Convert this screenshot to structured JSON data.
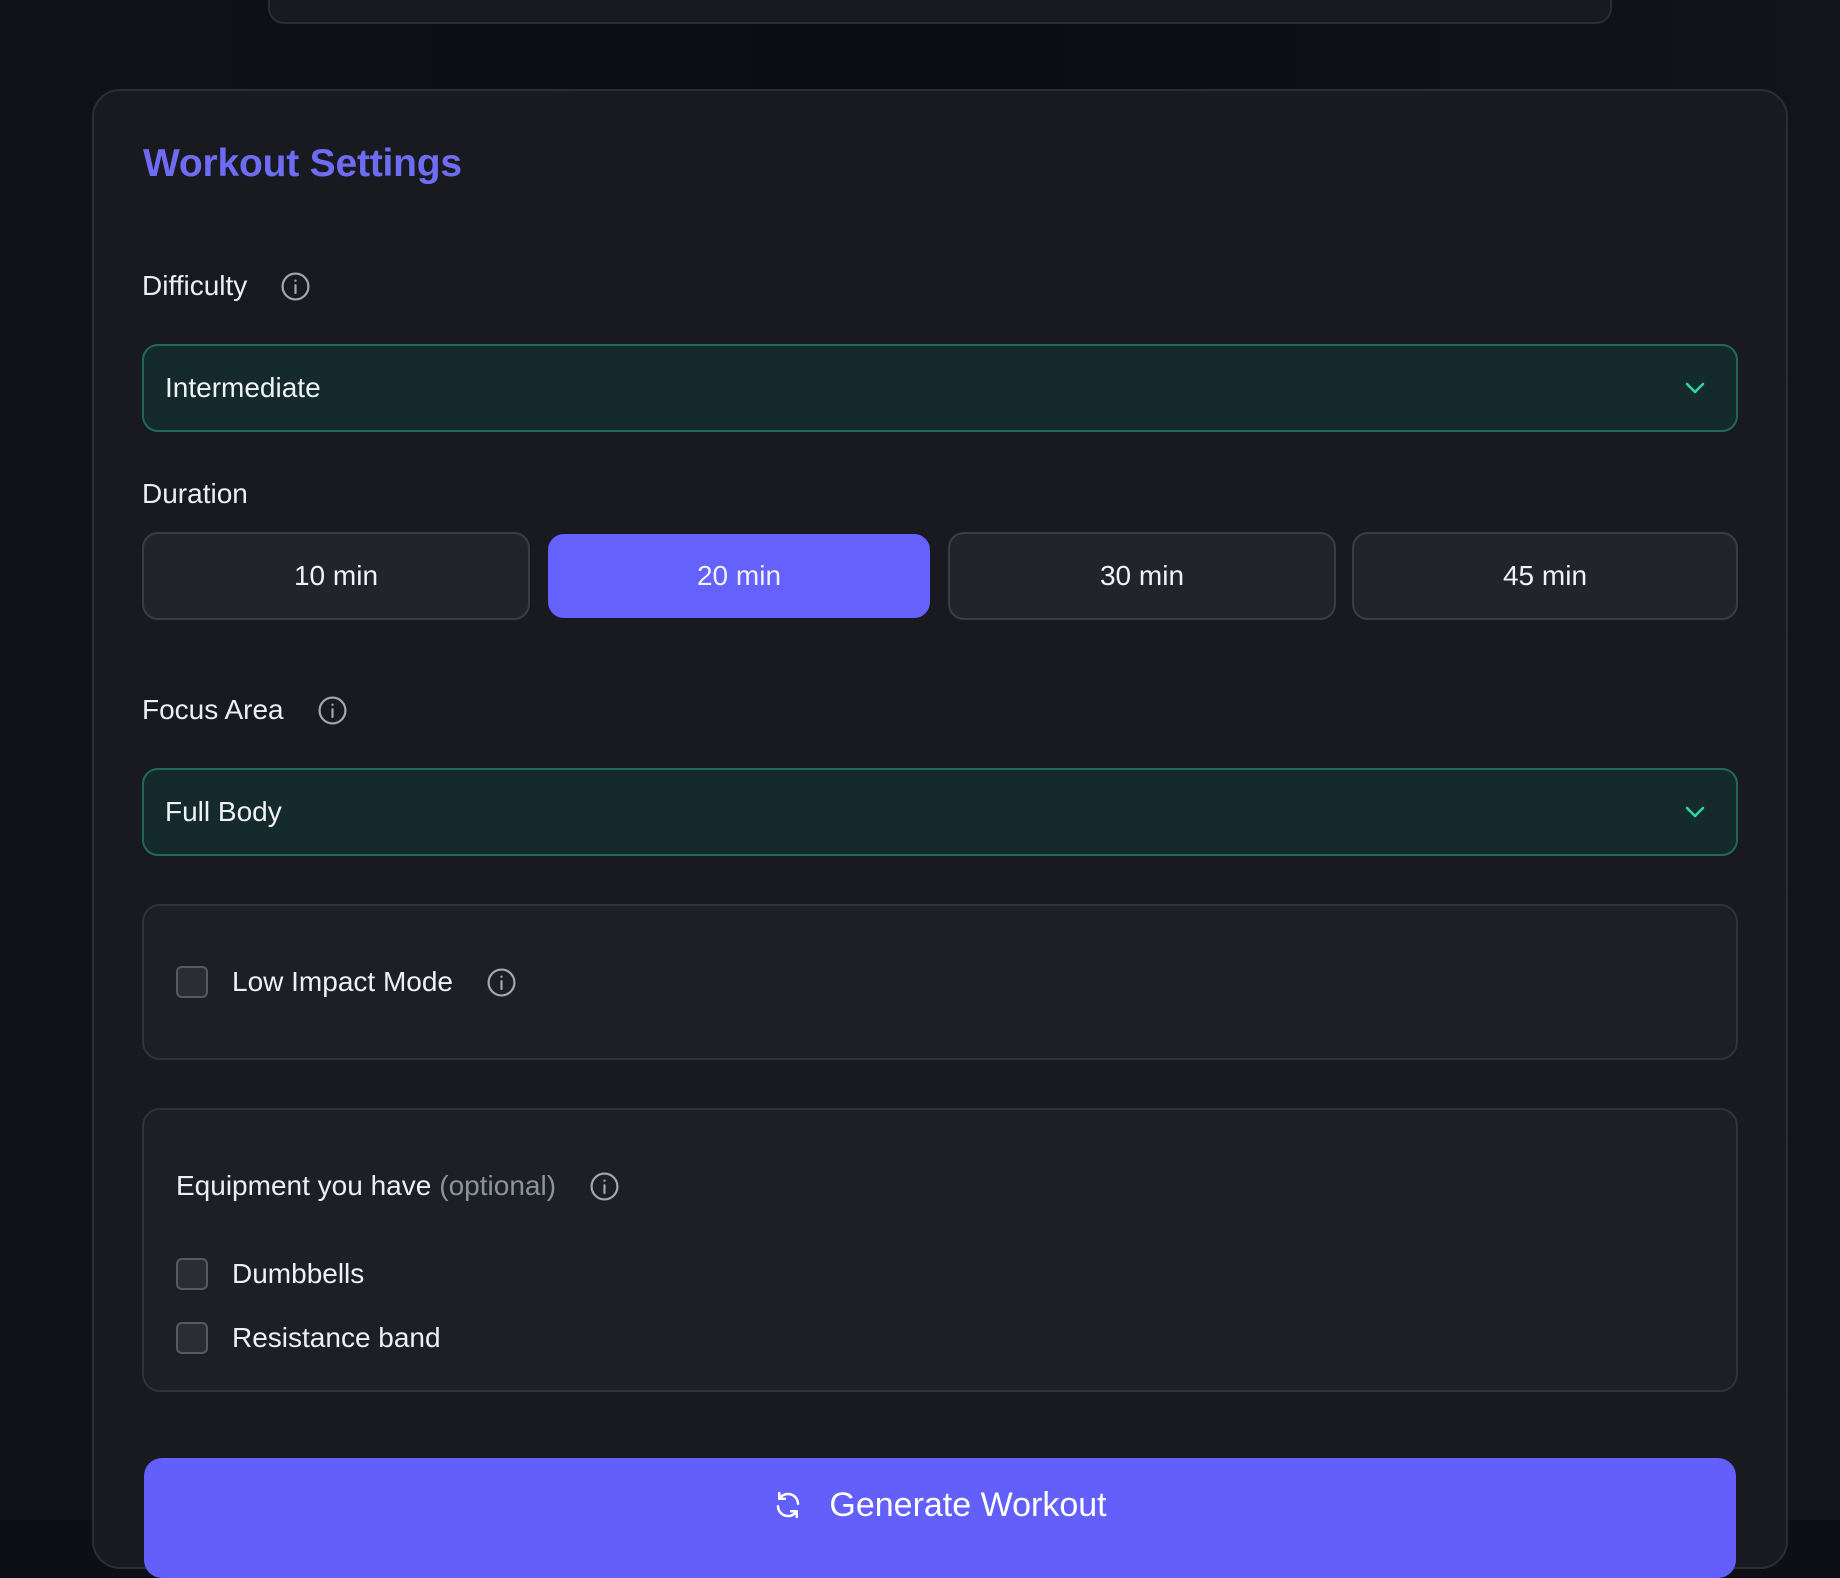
{
  "settings": {
    "title": "Workout Settings",
    "difficulty": {
      "label": "Difficulty",
      "selected": "Intermediate"
    },
    "duration": {
      "label": "Duration",
      "options": [
        "10 min",
        "20 min",
        "30 min",
        "45 min"
      ],
      "selected": "20 min"
    },
    "focus_area": {
      "label": "Focus Area",
      "selected": "Full Body"
    },
    "low_impact": {
      "label": "Low Impact Mode",
      "checked": false
    },
    "equipment": {
      "label": "Equipment you have",
      "optional_note": "(optional)",
      "items": [
        {
          "label": "Dumbbells",
          "checked": false
        },
        {
          "label": "Resistance band",
          "checked": false
        }
      ]
    },
    "generate_label": "Generate Workout"
  },
  "icons": {
    "info": "info-circle-icon",
    "chevron": "chevron-down-icon",
    "refresh": "refresh-icon"
  },
  "colors": {
    "accent": "#6461fd",
    "title": "#6f6cf4",
    "select_border": "#1f6a54",
    "chevron": "#2fd79a"
  }
}
